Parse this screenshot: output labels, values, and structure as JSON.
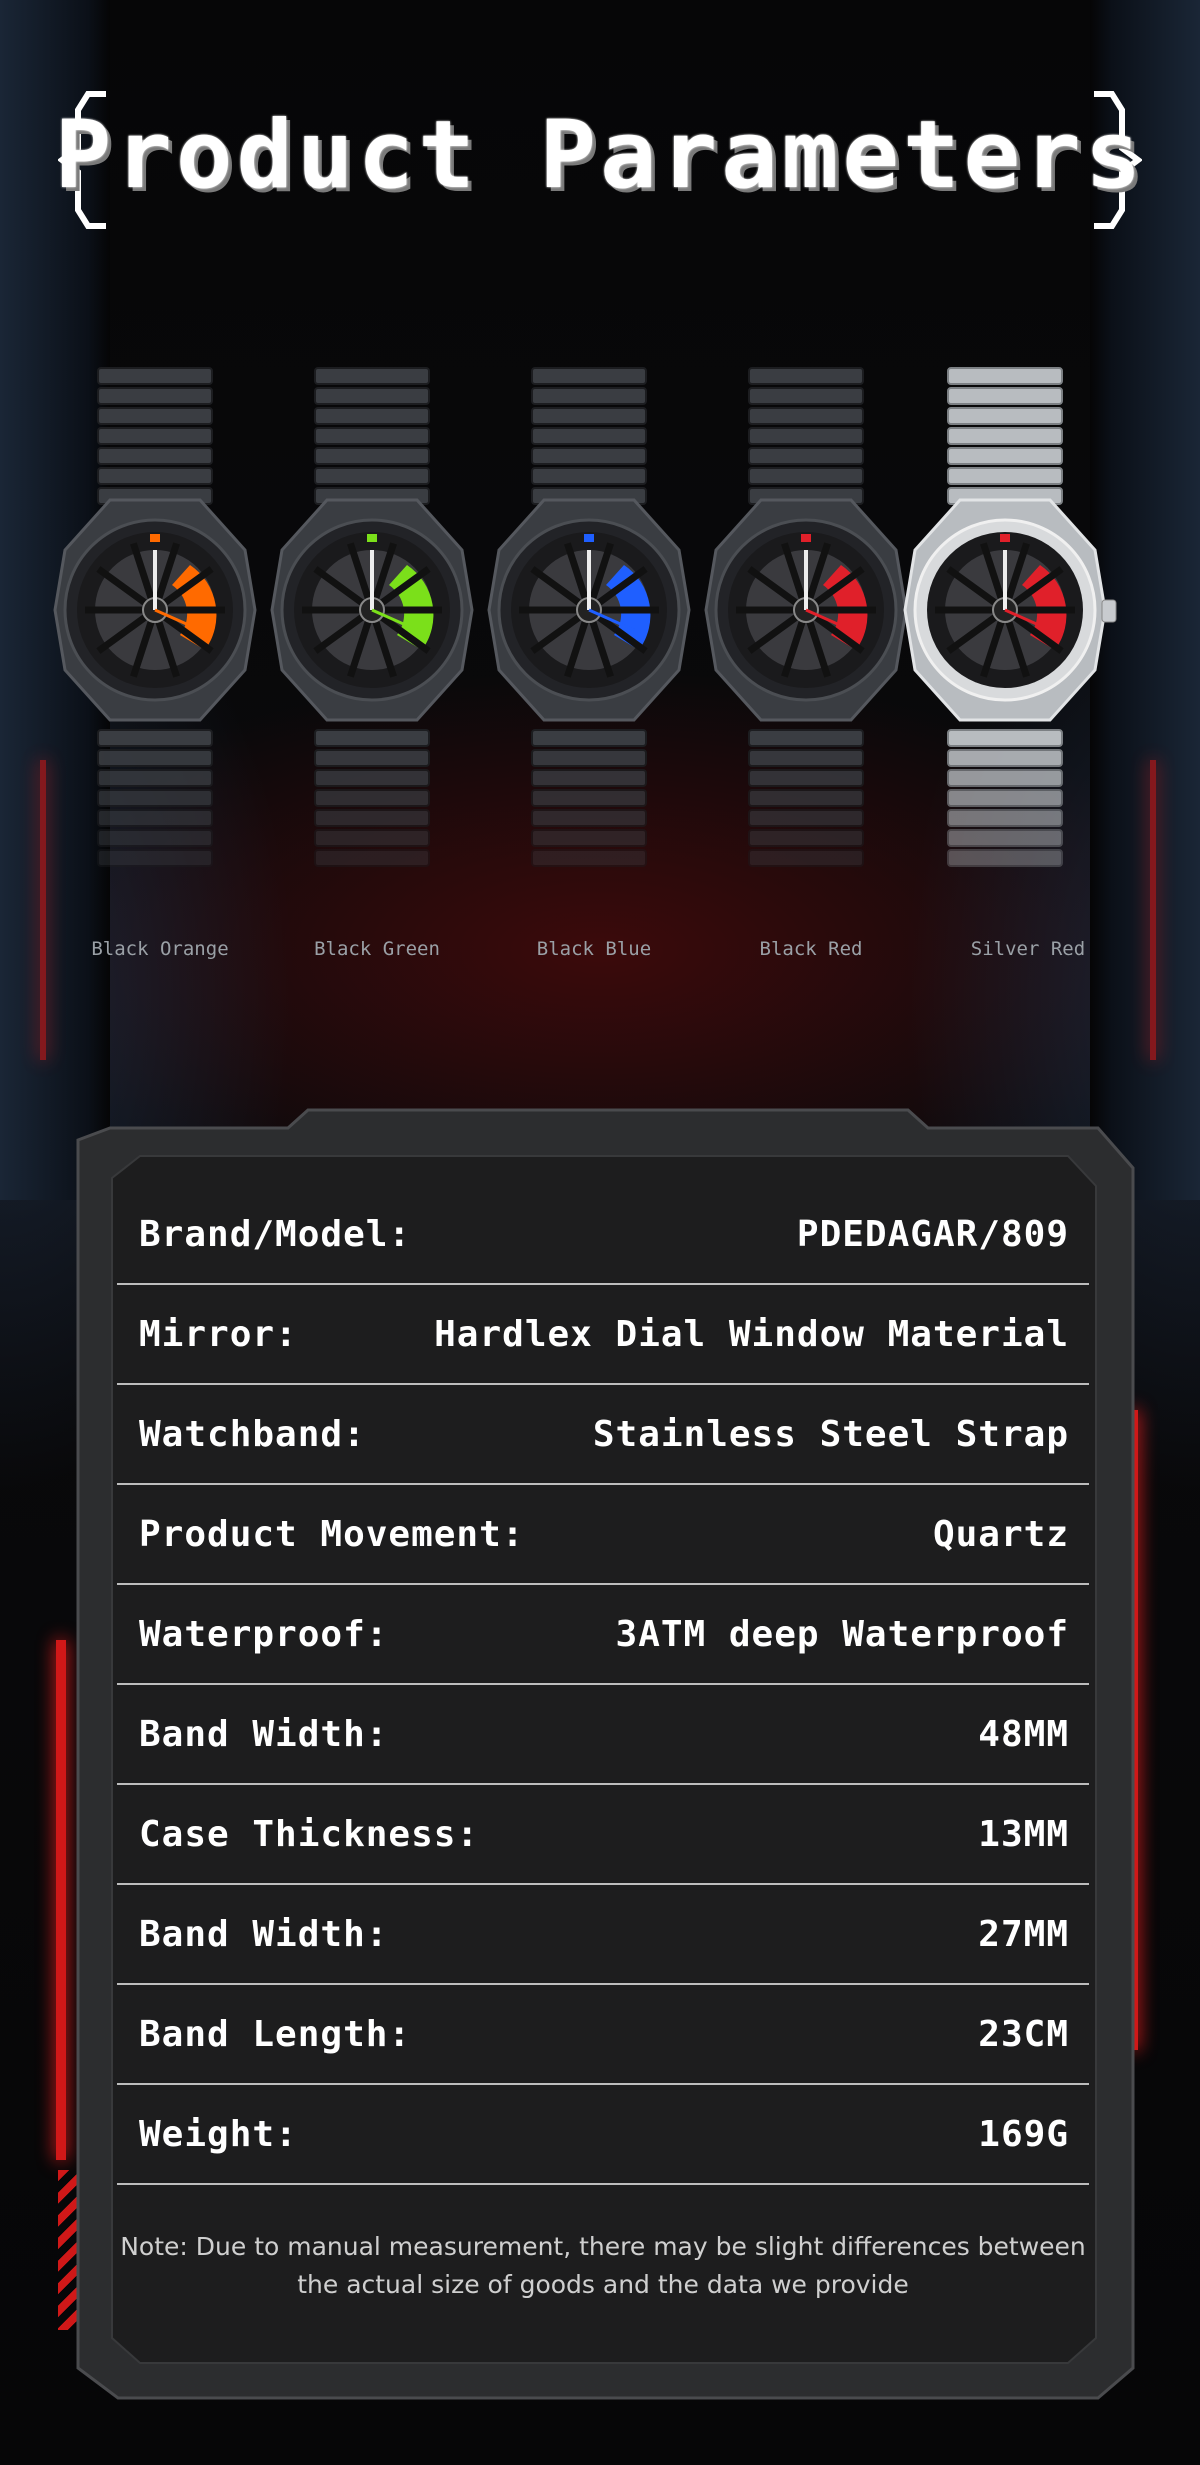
{
  "title": "Product Parameters",
  "colors": {
    "accent_red": "#d01818",
    "panel_bg": "#1e1e1f",
    "text": "#ffffff"
  },
  "watches": [
    {
      "label": "Black Orange",
      "accent": "#ff6a00",
      "case": "#3a3d42"
    },
    {
      "label": "Black Green",
      "accent": "#7be01a",
      "case": "#3a3d42"
    },
    {
      "label": "Black Blue",
      "accent": "#1f5fff",
      "case": "#3a3d42"
    },
    {
      "label": "Black Red",
      "accent": "#e0202a",
      "case": "#3a3d42"
    },
    {
      "label": "Silver Red",
      "accent": "#e0202a",
      "case": "#b8bcc0"
    }
  ],
  "specs": [
    {
      "key": "Brand/Model:",
      "value": "PDEDAGAR/809"
    },
    {
      "key": "Mirror:",
      "value": "Hardlex Dial Window Material"
    },
    {
      "key": "Watchband:",
      "value": "Stainless Steel Strap"
    },
    {
      "key": "Product Movement:",
      "value": "Quartz"
    },
    {
      "key": "Waterproof:",
      "value": "3ATM deep Waterproof"
    },
    {
      "key": "Band Width:",
      "value": "48MM"
    },
    {
      "key": "Case Thickness:",
      "value": "13MM"
    },
    {
      "key": "Band Width:",
      "value": "27MM"
    },
    {
      "key": "Band Length:",
      "value": "23CM"
    },
    {
      "key": "Weight:",
      "value": "169G"
    }
  ],
  "note": "Note: Due to manual measurement, there may be slight differences between the actual size of goods and the data we provide"
}
